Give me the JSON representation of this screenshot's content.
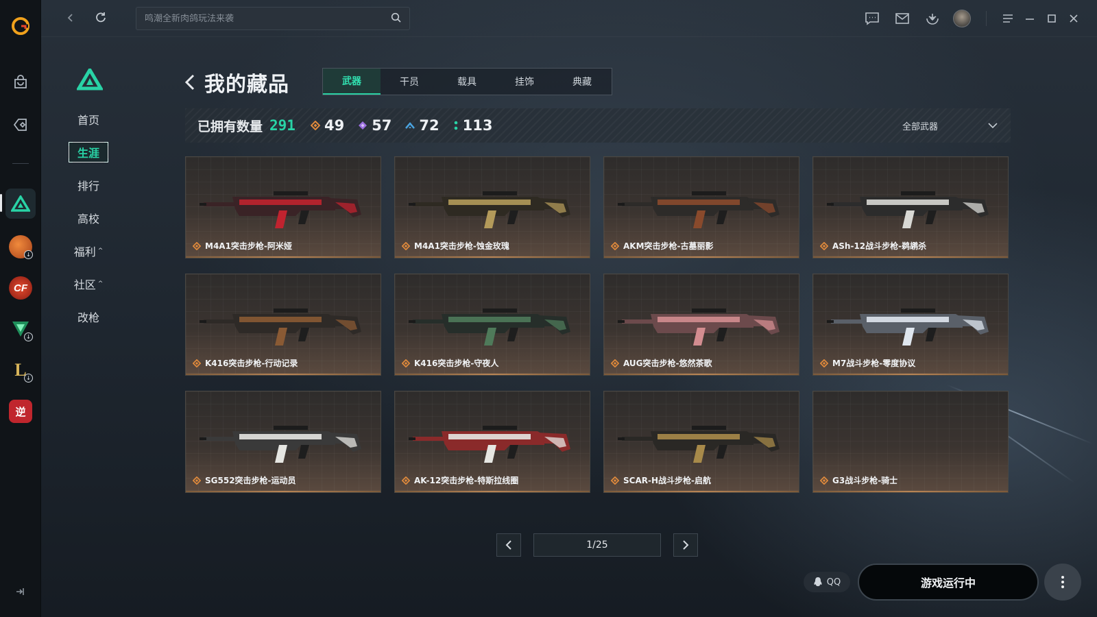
{
  "search": {
    "placeholder": "鸣潮全新肉鸽玩法来袭"
  },
  "sidebar": {
    "items": [
      {
        "label": "首页"
      },
      {
        "label": "生涯"
      },
      {
        "label": "排行"
      },
      {
        "label": "高校"
      },
      {
        "label": "福利"
      },
      {
        "label": "社区"
      },
      {
        "label": "改枪"
      }
    ]
  },
  "rail": {
    "games": [
      {
        "name": "basketball-game-icon",
        "color": "#e26a2c"
      },
      {
        "name": "crossfire-game-icon",
        "color": "#c0392b"
      },
      {
        "name": "valorant-like-game-icon",
        "color": "#1f8f5b"
      },
      {
        "name": "league-game-icon",
        "color": "#b8912f"
      },
      {
        "name": "ni-game-icon",
        "text": "逆",
        "color": "#c0262d"
      }
    ]
  },
  "page": {
    "title": "我的藏品"
  },
  "tabs": [
    "武器",
    "干员",
    "载具",
    "挂饰",
    "典藏"
  ],
  "stats": {
    "owned_label": "已拥有数量",
    "owned_count": "291",
    "rarities": [
      {
        "icon": "orange-diamond-icon",
        "color": "#e08a3c",
        "count": "49"
      },
      {
        "icon": "purple-diamond-icon",
        "color": "#9b6fe0",
        "count": "57"
      },
      {
        "icon": "blue-chevron-icon",
        "color": "#4aa3e0",
        "count": "72"
      },
      {
        "icon": "green-dots-icon",
        "color": "#29d3a6",
        "count": "113"
      }
    ],
    "filter_label": "全部武器"
  },
  "items": [
    {
      "name": "M4A1突击步枪-阿米娅",
      "accent": "#c0232f",
      "body": "#3a2326"
    },
    {
      "name": "M4A1突击步枪-蚀金玫瑰",
      "accent": "#b39a5a",
      "body": "#2e2a22"
    },
    {
      "name": "AKM突击步枪-古墓丽影",
      "accent": "#8a4a2c",
      "body": "#2d2b29"
    },
    {
      "name": "ASh-12战斗步枪-鹈鹕杀",
      "accent": "#d8d8d4",
      "body": "#2c2c2c"
    },
    {
      "name": "K416突击步枪-行动记录",
      "accent": "#8a5a34",
      "body": "#2e2a27"
    },
    {
      "name": "K416突击步枪-守夜人",
      "accent": "#4f7a5a",
      "body": "#262e2a"
    },
    {
      "name": "AUG突击步枪-悠然茶歌",
      "accent": "#d38d90",
      "body": "#6c4a4c"
    },
    {
      "name": "M7战斗步枪-零度协议",
      "accent": "#dfe6ee",
      "body": "#5a6069"
    },
    {
      "name": "SG552突击步枪-运动员",
      "accent": "#e6e6e2",
      "body": "#3a3a3a"
    },
    {
      "name": "AK-12突击步枪-特斯拉线圈",
      "accent": "#e6e6e2",
      "body": "#8a2a2a"
    },
    {
      "name": "SCAR-H战斗步枪-启航",
      "accent": "#a88a4a",
      "body": "#2a2825"
    },
    {
      "name": "G3战斗步枪-骑士",
      "accent": "",
      "body": ""
    }
  ],
  "pagination": {
    "display": "1/25"
  },
  "footer": {
    "qq_label": "QQ",
    "run_label": "游戏运行中"
  }
}
